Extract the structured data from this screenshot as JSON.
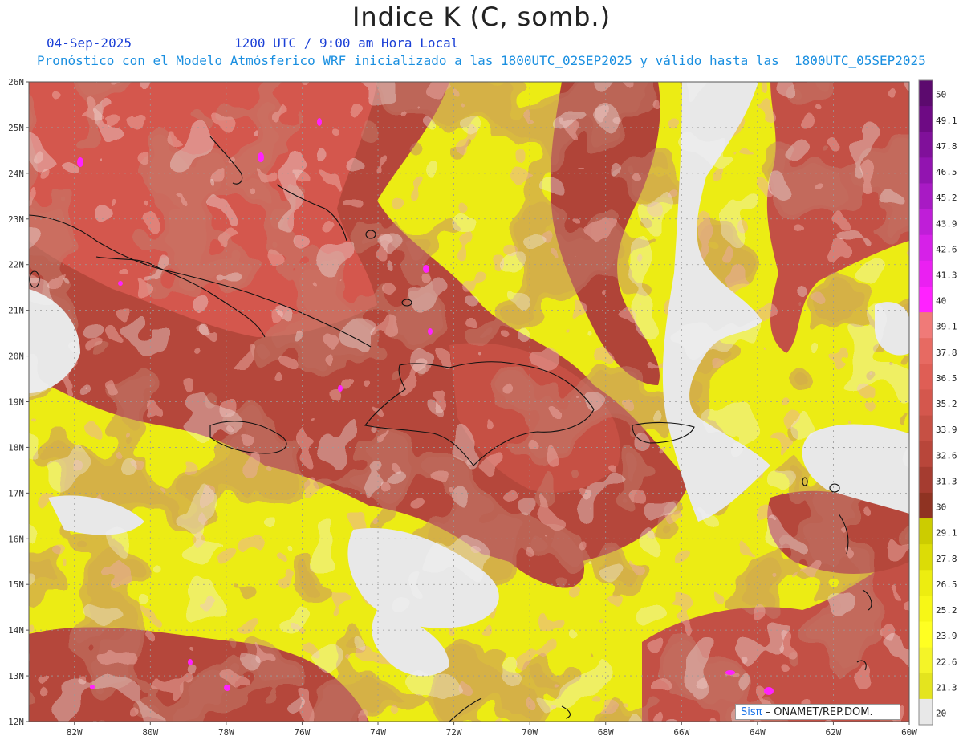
{
  "header": {
    "title": "Indice K (C, somb.)",
    "date": "04-Sep-2025",
    "time": "1200 UTC / 9:00 am Hora Local",
    "forecast": "Pronóstico con el Modelo Atmósferico WRF inicializado a las 1800UTC_02SEP2025 y válido hasta las  1800UTC_05SEP2025"
  },
  "map": {
    "lon_labels": [
      "82W",
      "80W",
      "78W",
      "76W",
      "74W",
      "72W",
      "70W",
      "68W",
      "66W",
      "64W",
      "62W",
      "60W"
    ],
    "lat_labels": [
      "26N",
      "25N",
      "24N",
      "23N",
      "22N",
      "21N",
      "20N",
      "19N",
      "18N",
      "17N",
      "16N",
      "15N",
      "14N",
      "13N",
      "12N"
    ],
    "lon_range": [
      -83.2,
      -60
    ],
    "lat_range": [
      12,
      26
    ],
    "grid": true
  },
  "colorbar": {
    "labels": [
      "50",
      "49.1",
      "47.8",
      "46.5",
      "45.2",
      "43.9",
      "42.6",
      "41.3",
      "40",
      "39.1",
      "37.8",
      "36.5",
      "35.2",
      "33.9",
      "32.6",
      "31.3",
      "30",
      "29.1",
      "27.8",
      "26.5",
      "25.2",
      "23.9",
      "22.6",
      "21.3",
      "20"
    ],
    "colors": [
      "#5c0a6e",
      "#6e0a84",
      "#80109a",
      "#9214b0",
      "#a81ac4",
      "#bf1ed8",
      "#d621e8",
      "#ea20f2",
      "#ff22ff",
      "#f07a78",
      "#e76a62",
      "#df5e55",
      "#d4574d",
      "#c65044",
      "#b8463a",
      "#a53c30",
      "#8f3322",
      "#cccc00",
      "#dcdc06",
      "#eded10",
      "#f7f716",
      "#ffff22",
      "#f4f428",
      "#e4e41e",
      "#d0d012"
    ],
    "below_color": "#e8e8e8"
  },
  "credit": {
    "logo": "Sisπ",
    "text": "– ONAMET/REP.DOM."
  }
}
